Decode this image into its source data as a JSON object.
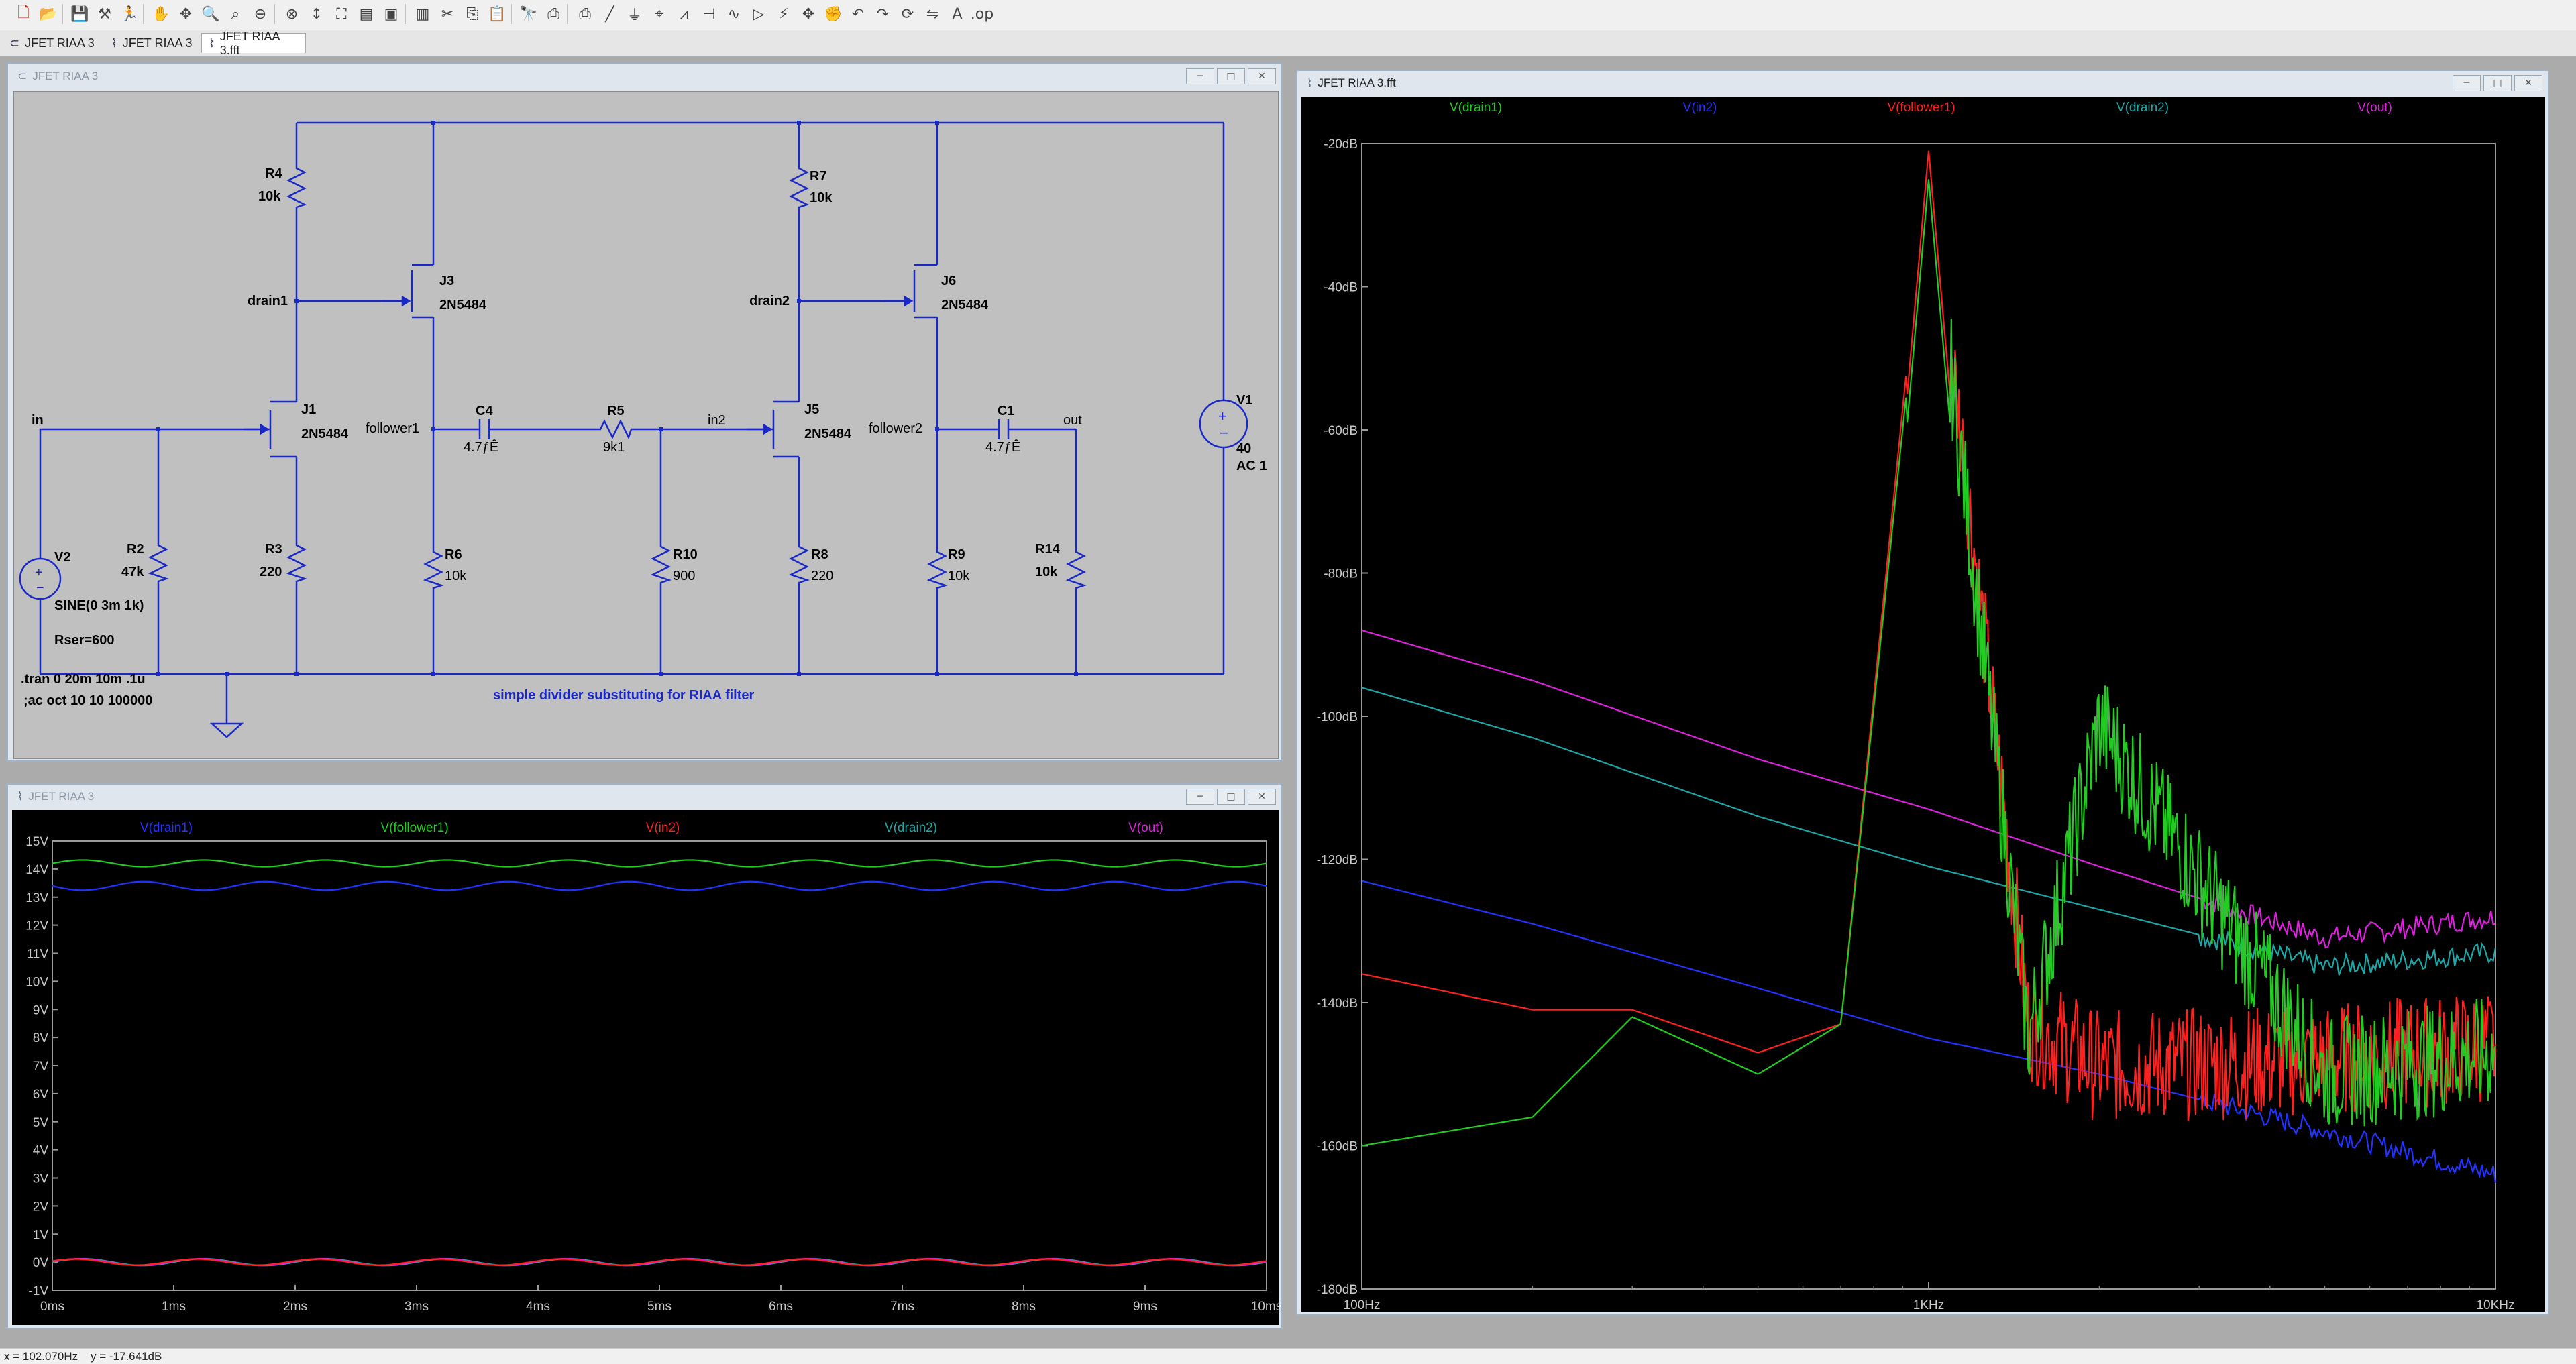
{
  "toolbar": {
    "icons": [
      "new-schematic-icon",
      "open-icon",
      "save-icon",
      "control-panel-icon",
      "run-icon",
      "halt-icon",
      "pan-icon",
      "zoom-in-icon",
      "zoom-full-icon",
      "zoom-out-icon",
      "zoom-cancel-icon",
      "autorange-icon",
      "fit-icon",
      "tile-horizontal-icon",
      "cascade-icon",
      "tile-vertical-icon",
      "cut-icon",
      "copy-icon",
      "paste-icon",
      "find-icon",
      "print-preview-icon",
      "print-icon",
      "wire-icon",
      "ground-icon",
      "label-icon",
      "resistor-icon",
      "capacitor-icon",
      "inductor-icon",
      "diode-icon",
      "component-icon",
      "move-icon",
      "drag-icon",
      "undo-icon",
      "redo-icon",
      "rotate-icon",
      "mirror-icon",
      "text-icon",
      "spice-directive-icon"
    ]
  },
  "tabs": [
    {
      "label": "JFET RIAA 3",
      "icon": "schematic-icon"
    },
    {
      "label": "JFET RIAA 3",
      "icon": "waveform-icon"
    },
    {
      "label": "JFET RIAA 3.fft",
      "icon": "waveform-icon"
    }
  ],
  "schematic": {
    "title": "JFET RIAA 3",
    "parts": {
      "R4": {
        "name": "R4",
        "value": "10k"
      },
      "J3": {
        "name": "J3",
        "value": "2N5484"
      },
      "R7": {
        "name": "R7",
        "value": "10k"
      },
      "J6": {
        "name": "J6",
        "value": "2N5484"
      },
      "J1": {
        "name": "J1",
        "value": "2N5484"
      },
      "C4": {
        "name": "C4",
        "value": "4.7ƒÊ"
      },
      "R5": {
        "name": "R5",
        "value": "9k1"
      },
      "J5": {
        "name": "J5",
        "value": "2N5484"
      },
      "C1": {
        "name": "C1",
        "value": "4.7ƒÊ"
      },
      "V1": {
        "name": "V1",
        "value": "40",
        "value2": "AC 1"
      },
      "R2": {
        "name": "R2",
        "value": "47k"
      },
      "R3": {
        "name": "R3",
        "value": "220"
      },
      "R6": {
        "name": "R6",
        "value": "10k"
      },
      "R10": {
        "name": "R10",
        "value": "900"
      },
      "R8": {
        "name": "R8",
        "value": "220"
      },
      "R9": {
        "name": "R9",
        "value": "10k"
      },
      "R14": {
        "name": "R14",
        "value": "10k"
      },
      "V2": {
        "name": "V2",
        "value": "SINE(0 3m 1k)",
        "value2": "Rser=600"
      }
    },
    "nets": {
      "drain1": "drain1",
      "drain2": "drain2",
      "in": "in",
      "follower1": "follower1",
      "in2": "in2",
      "follower2": "follower2",
      "out": "out"
    },
    "directives": [
      ".tran 0 20m 10m .1u",
      ";ac oct 10 10 100000"
    ],
    "comment": "simple divider substituting for RIAA filter",
    "colors": {
      "background": "#c0c0c0",
      "wire": "#1a28c8",
      "text": "#000000"
    }
  },
  "waveform": {
    "title": "JFET RIAA 3",
    "traces": [
      {
        "name": "V(drain1)",
        "color": "#2233ff"
      },
      {
        "name": "V(follower1)",
        "color": "#22cc22"
      },
      {
        "name": "V(in2)",
        "color": "#ff2020"
      },
      {
        "name": "V(drain2)",
        "color": "#1ca7a7"
      },
      {
        "name": "V(out)",
        "color": "#e020e0"
      }
    ],
    "y_ticks": [
      "15V",
      "14V",
      "13V",
      "12V",
      "11V",
      "10V",
      "9V",
      "8V",
      "7V",
      "6V",
      "5V",
      "4V",
      "3V",
      "2V",
      "1V",
      "0V",
      "-1V"
    ],
    "x_ticks": [
      "0ms",
      "1ms",
      "2ms",
      "3ms",
      "4ms",
      "5ms",
      "6ms",
      "7ms",
      "8ms",
      "9ms",
      "10ms"
    ],
    "levels": {
      "follower1": 14.2,
      "drain1": 13.4,
      "low": 0.0
    },
    "ylim": [
      -1,
      15
    ],
    "xlim": [
      0,
      10
    ],
    "ripple": {
      "follower1": 0.12,
      "drain1": 0.15,
      "low": 0.12
    },
    "cycles": 10
  },
  "fft": {
    "title": "JFET RIAA 3.fft",
    "traces": [
      {
        "name": "V(drain1)",
        "color": "#22cc22"
      },
      {
        "name": "V(in2)",
        "color": "#2233ff"
      },
      {
        "name": "V(follower1)",
        "color": "#ff2020"
      },
      {
        "name": "V(drain2)",
        "color": "#1ca7a7"
      },
      {
        "name": "V(out)",
        "color": "#e020e0"
      }
    ],
    "y_ticks": [
      "-20dB",
      "-40dB",
      "-60dB",
      "-80dB",
      "-100dB",
      "-120dB",
      "-140dB",
      "-160dB",
      "-180dB"
    ],
    "x_ticks": [
      "100Hz",
      "1KHz",
      "10KHz"
    ],
    "chart_data": {
      "type": "line",
      "xscale": "log",
      "xlim": [
        100,
        10000
      ],
      "ylim": [
        -180,
        -20
      ],
      "ylabel": "",
      "xlabel": "",
      "series": [
        {
          "name": "V(out)",
          "x": [
            100,
            200,
            500,
            1000,
            2000,
            5000,
            10000
          ],
          "y": [
            -88,
            -95,
            -106,
            -113,
            -121,
            -131,
            -128
          ]
        },
        {
          "name": "V(drain2)",
          "x": [
            100,
            200,
            500,
            1000,
            2000,
            5000,
            10000
          ],
          "y": [
            -96,
            -103,
            -114,
            -121,
            -127,
            -135,
            -133
          ]
        },
        {
          "name": "V(in2)",
          "x": [
            100,
            200,
            500,
            1000,
            2000,
            5000,
            10000
          ],
          "y": [
            -123,
            -129,
            -138,
            -145,
            -150,
            -158,
            -164
          ]
        },
        {
          "name": "V(follower1)",
          "x": [
            100,
            200,
            300,
            500,
            700,
            1000,
            1500,
            2000,
            5000,
            10000
          ],
          "y": [
            -136,
            -141,
            -141,
            -147,
            -143,
            -21,
            -143,
            -149,
            -148,
            -146
          ]
        },
        {
          "name": "V(drain1)",
          "x": [
            100,
            200,
            300,
            500,
            700,
            1000,
            1500,
            2000,
            5000,
            10000
          ],
          "y": [
            -160,
            -156,
            -142,
            -150,
            -143,
            -25,
            -145,
            -101,
            -150,
            -147
          ]
        }
      ]
    }
  },
  "status": {
    "cursor": "x = 102.070Hz    y = -17.641dB"
  }
}
